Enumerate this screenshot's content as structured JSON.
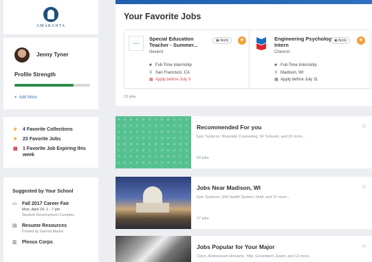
{
  "school": {
    "name": "AMARANTA"
  },
  "profile": {
    "name": "Jenny Tyner",
    "strength_label": "Profile Strength",
    "strength_value": 0.78,
    "add_more": "Add More"
  },
  "stats": [
    {
      "icon": "star-icon",
      "label": "4 Favorite Collections"
    },
    {
      "icon": "star-icon",
      "label": "23 Favorite Jobs"
    },
    {
      "icon": "calendar-icon",
      "label": "1 Favorite Job Expiring this week"
    }
  ],
  "suggested": {
    "title": "Suggested by Your School",
    "items": [
      {
        "icon": "calendar-icon",
        "title": "Fall 2017 Career Fair",
        "line1": "Mon, April 24, 1 - 7 pm",
        "line2": "Student Development Complex"
      },
      {
        "icon": "document-icon",
        "title": "Resume Resources",
        "line1": "Posted by Garrett Martel",
        "line2": ""
      },
      {
        "icon": "building-icon",
        "title": "Plexus Corps",
        "line1": "",
        "line2": ""
      }
    ]
  },
  "favorites": {
    "title": "Your Favorite Jobs",
    "count": "23 jobs",
    "jobs": [
      {
        "logo_text": "nexient",
        "title": "Special Education Teacher - Summer...",
        "company": "Nexient",
        "apply_label": "Apply",
        "type": "Full-Time Internship",
        "location": "San Francisco, CA",
        "deadline": "Apply before July 3"
      },
      {
        "logo_text": "",
        "title": "Engineering Psychology Intern",
        "company": "Chevron",
        "apply_label": "Apply",
        "type": "Full-Time Internship",
        "location": "Madison, WI",
        "deadline": "Apply before July 31"
      }
    ]
  },
  "lists": [
    {
      "title": "Recommended For you",
      "subtitle": "Epic Systems, Riverside Counseling, SF Schools, and 32 more...",
      "count": "50 jobs"
    },
    {
      "title": "Jobs Near Madison, WI",
      "subtitle": "Epic Systems, UW Health System, Hudl, and 21 more...",
      "count": "27 jobs"
    },
    {
      "title": "Jobs Popular for Your Major",
      "subtitle": "Cisco, Andreessen Horowitz, Yelp, Genentech, Exam, and 13 more...",
      "count": ""
    }
  ],
  "colors": {
    "accent_blue": "#1f5fae",
    "strength_green": "#2f8a48",
    "favorite_orange": "#f2a23a",
    "deadline_red": "#d24545"
  }
}
